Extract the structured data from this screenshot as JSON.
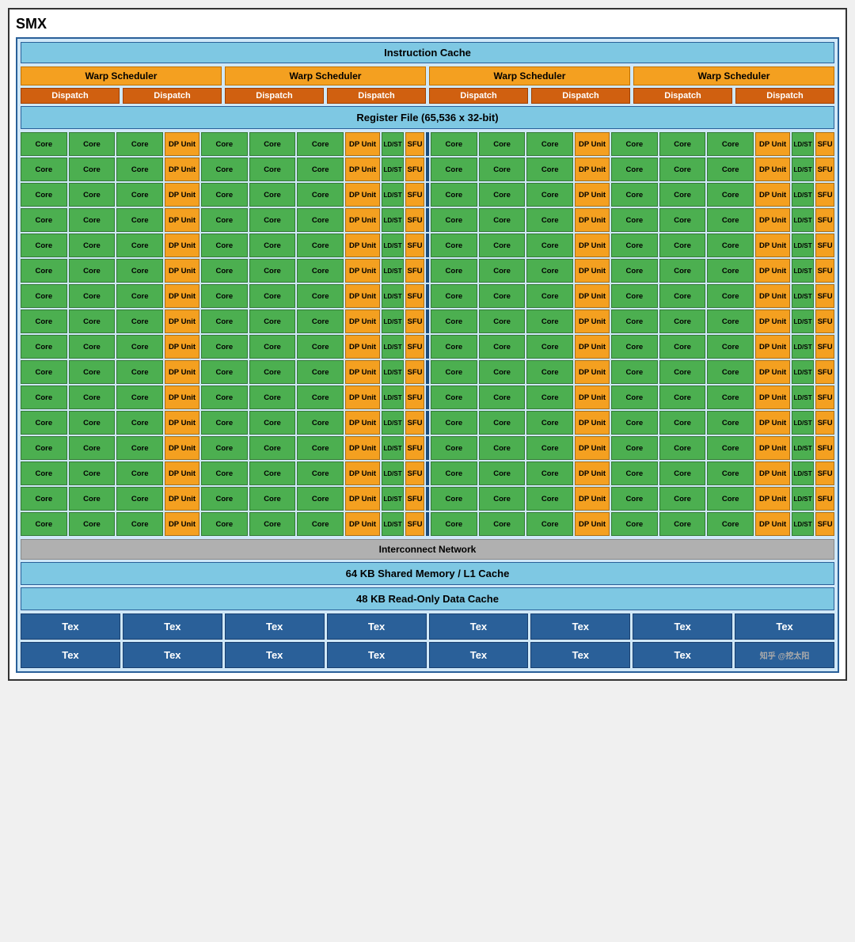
{
  "title": "SMX",
  "instruction_cache": "Instruction Cache",
  "warp_schedulers": [
    "Warp Scheduler",
    "Warp Scheduler",
    "Warp Scheduler",
    "Warp Scheduler"
  ],
  "dispatch_units": [
    "Dispatch",
    "Dispatch",
    "Dispatch",
    "Dispatch",
    "Dispatch",
    "Dispatch",
    "Dispatch",
    "Dispatch"
  ],
  "register_file": "Register File (65,536 x 32-bit)",
  "interconnect": "Interconnect Network",
  "shared_memory": "64 KB Shared Memory / L1 Cache",
  "readonly_cache": "48 KB Read-Only Data Cache",
  "tex_label": "Tex",
  "num_core_rows": 16,
  "watermark": "知乎 @挖太阳"
}
